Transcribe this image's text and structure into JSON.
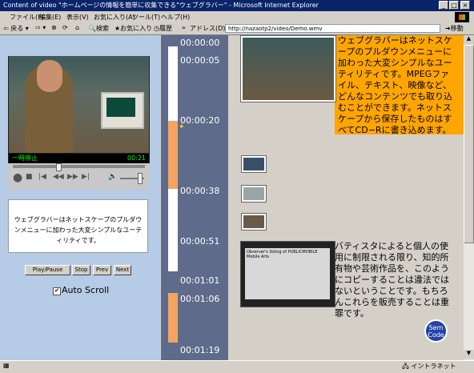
{
  "window": {
    "title": "Content of video \"ホームページの情報を簡単に収集できる\"ウェブグラバー\" - Microsoft Internet Explorer"
  },
  "menu": [
    "ファイル(F)",
    "編集(E)",
    "表示(V)",
    "お気に入り(A)",
    "ツール(T)",
    "ヘルプ(H)"
  ],
  "toolbar": {
    "back": "戻る",
    "search": "検索",
    "favorites": "お気に入り",
    "history": "履歴",
    "address_label": "アドレス(D)",
    "address": "http://nazaotp2/video/Demo.wmv",
    "go": "移動"
  },
  "player": {
    "state": "一時停止",
    "time": "00:21"
  },
  "caption": "ウェブグラバーはネットスケープのプルダウンメニューに加わった大変シンプルなユーティリティです。",
  "buttons": {
    "play_pause": "Play/Pause",
    "stop": "Stop",
    "prev": "Prev",
    "next": "Next"
  },
  "autoscroll": "Auto Scroll",
  "timeline": [
    "00:00:00",
    "00:00:05",
    "00:00:20",
    "00:00:38",
    "00:00:51",
    "00:01:01",
    "00:01:06",
    "00:01:19"
  ],
  "segment1_text": "ウェブグラバーはネットスケープのプルダウンメニューに加わった大変シンプルなユーティリティです。MPEGファイル、テキスト、映像など、どんなコンテンツでも取り込むことができます。ネットスケープから保存したものはすべてCD−Rに書き込めます。",
  "segment2_text": "バティスタによると個人の使用に制限される限り、知的所有物や芸術作品を、このようにコピーすることは違法ではないということです。もちろんこれらを販売することは重罪です。",
  "shot_text": "Observer's listing of PUBLICMOBILE Mobile Arts",
  "badge": "Sem Code",
  "status": {
    "zone": "イントラネット"
  }
}
